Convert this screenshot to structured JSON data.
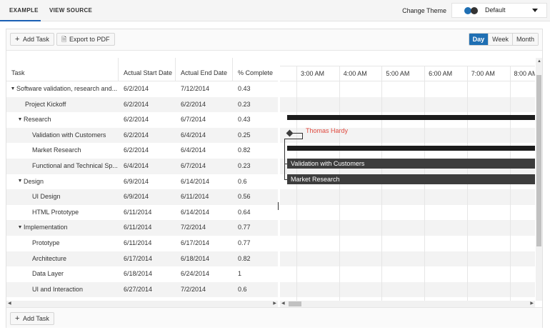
{
  "tabs": [
    {
      "label": "EXAMPLE",
      "active": true
    },
    {
      "label": "VIEW SOURCE",
      "active": false
    }
  ],
  "theme": {
    "label": "Change Theme",
    "value": "Default"
  },
  "toolbar": {
    "add_task": "Add Task",
    "export_pdf": "Export to PDF",
    "views": [
      "Day",
      "Week",
      "Month"
    ],
    "active_view": "Day"
  },
  "columns": [
    "Task",
    "Actual Start Date",
    "Actual End Date",
    "% Complete"
  ],
  "rows": [
    {
      "task": "Software validation, research and...",
      "start": "6/2/2014",
      "end": "7/12/2014",
      "pct": "0.43",
      "level": 0,
      "expandable": true
    },
    {
      "task": "Project Kickoff",
      "start": "6/2/2014",
      "end": "6/2/2014",
      "pct": "0.23",
      "level": 1,
      "expandable": false
    },
    {
      "task": "Research",
      "start": "6/2/2014",
      "end": "6/7/2014",
      "pct": "0.43",
      "level": 1,
      "expandable": true
    },
    {
      "task": "Validation with Customers",
      "start": "6/2/2014",
      "end": "6/4/2014",
      "pct": "0.25",
      "level": 2,
      "expandable": false
    },
    {
      "task": "Market Research",
      "start": "6/2/2014",
      "end": "6/4/2014",
      "pct": "0.82",
      "level": 2,
      "expandable": false
    },
    {
      "task": "Functional and Technical Sp...",
      "start": "6/4/2014",
      "end": "6/7/2014",
      "pct": "0.23",
      "level": 2,
      "expandable": false
    },
    {
      "task": "Design",
      "start": "6/9/2014",
      "end": "6/14/2014",
      "pct": "0.6",
      "level": 1,
      "expandable": true
    },
    {
      "task": "UI Design",
      "start": "6/9/2014",
      "end": "6/11/2014",
      "pct": "0.56",
      "level": 2,
      "expandable": false
    },
    {
      "task": "HTML Prototype",
      "start": "6/11/2014",
      "end": "6/14/2014",
      "pct": "0.64",
      "level": 2,
      "expandable": false
    },
    {
      "task": "Implementation",
      "start": "6/11/2014",
      "end": "7/2/2014",
      "pct": "0.77",
      "level": 1,
      "expandable": true
    },
    {
      "task": "Prototype",
      "start": "6/11/2014",
      "end": "6/17/2014",
      "pct": "0.77",
      "level": 2,
      "expandable": false
    },
    {
      "task": "Architecture",
      "start": "6/17/2014",
      "end": "6/18/2014",
      "pct": "0.82",
      "level": 2,
      "expandable": false
    },
    {
      "task": "Data Layer",
      "start": "6/18/2014",
      "end": "6/24/2014",
      "pct": "1",
      "level": 2,
      "expandable": false
    },
    {
      "task": "UI and Interaction",
      "start": "6/27/2014",
      "end": "7/2/2014",
      "pct": "0.6",
      "level": 2,
      "expandable": false
    }
  ],
  "timeline": {
    "hours": [
      "3:00 AM",
      "4:00 AM",
      "5:00 AM",
      "6:00 AM",
      "7:00 AM",
      "8:00 AM"
    ],
    "milestone_label": "Thomas Hardy",
    "bar_labels": [
      "Validation with Customers",
      "Market Research"
    ]
  },
  "colors": {
    "accent": "#1f6fb3",
    "bar": "#3d3d3d",
    "summary": "#1c1c1c",
    "resource": "#e04a3f"
  }
}
